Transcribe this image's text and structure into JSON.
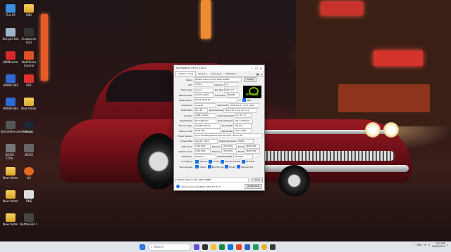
{
  "desktop": {
    "icons": [
      {
        "label": "This PC"
      },
      {
        "label": "MRI"
      },
      {
        "label": "Recycle Bin"
      },
      {
        "label": "Cinebench R23"
      },
      {
        "label": "HWMonitor"
      },
      {
        "label": "NeXtPulse Control"
      },
      {
        "label": "HWiNFO64"
      },
      {
        "label": "PDF"
      },
      {
        "label": "HWiNFO64"
      },
      {
        "label": "New folder"
      },
      {
        "label": "DetroitBecomeHuman"
      },
      {
        "label": "Steam"
      },
      {
        "label": "DS3Gi - CON..."
      },
      {
        "label": "DS3Gi"
      },
      {
        "label": "New folder"
      },
      {
        "label": "LIA"
      },
      {
        "label": "New folder"
      },
      {
        "label": "DNS"
      },
      {
        "label": "New folder"
      },
      {
        "label": "BattleField 1"
      }
    ]
  },
  "gpuz": {
    "title": "TechPowerUp GPU-Z 2.60.0",
    "controls": [
      "–",
      "□",
      "✕"
    ],
    "tabs": [
      "Graphics Card",
      "Sensors",
      "Advanced",
      "Validation"
    ],
    "tab_icons": [
      "camera",
      "menu"
    ],
    "name_label": "Name",
    "name_value": "NVIDIA GeForce GTX 1660 SUPER",
    "lookup": "Lookup",
    "gpu_label": "GPU",
    "gpu_value": "TU116",
    "revision_label": "Revision",
    "revision_value": "A1",
    "tech_label": "Technology",
    "tech_value": "12 nm",
    "diesize_label": "Die Size",
    "diesize_value": "284 mm²",
    "release_label": "Release Date",
    "release_value": "Oct 29, 2019",
    "transistors_label": "Transistors",
    "transistors_value": "6600M",
    "bios_label": "BIOS Version",
    "bios_value": "90.16.4F.40.7E",
    "uefi_label": "UEFI",
    "subvendor_label": "Subvendor",
    "subvendor_value": "Colorful",
    "deviceid_label": "Device ID",
    "deviceid_value": "10DE 21C4 - 7377 1001",
    "rops_label": "ROPs/TMUs",
    "rops_value": "48 / 88",
    "businterface_label": "Bus Interface",
    "businterface_value": "PCIe x16 3.0 @ x16 1.1",
    "shaders_label": "Shaders",
    "shaders_value": "1408 Unified",
    "dx_label": "DirectX Support",
    "dx_value": "12 (12_1)",
    "pixel_label": "Pixel Fillrate",
    "pixel_value": "87.8 GPixel/s",
    "texture_label": "Texture Fillrate",
    "texture_value": "161.0 GTexel/s",
    "memtype_label": "Memory Type",
    "memtype_value": "GDDR6 (Hynix)",
    "buswidth_label": "Bus Width",
    "buswidth_value": "192 bit",
    "memsize_label": "Memory Size",
    "memsize_value": "6144 MB",
    "bandwidth_label": "Bandwidth",
    "bandwidth_value": "336.0 GB/s",
    "driverver_label": "Driver Version",
    "driverver_value": "32.0.15.6590 (NVIDIA 565.90) DCH / Win11 64",
    "driverdate_label": "Driver Date",
    "driverdate_value": "Sep 26, 2024",
    "digsig_label": "Digital Signature",
    "digsig_value": "WHQL",
    "gpuclock_label": "GPU Clock",
    "gpuclock_value": "1530 MHz",
    "memory_label": "Memory",
    "memory_value": "1750 MHz",
    "boost_label": "Boost",
    "boost_value": "1830 MHz",
    "defclock_label": "Default Clock",
    "defclock_value": "1530 MHz",
    "defmemory_value": "1750 MHz",
    "defboost_value": "1830 MHz",
    "sli_label": "NVIDIA SLI",
    "sli_value": "Disabled",
    "rebar_label": "Resizable BAR",
    "rebar_value": "Disabled",
    "computing_label": "Computing",
    "computing": [
      "OpenCL",
      "CUDA",
      "DirectCompute",
      "DirectML"
    ],
    "tech_row_label": "Technologies",
    "technologies": [
      "Vulkan",
      "Ray Tracing",
      "PhysX",
      "OpenGL 4.6"
    ],
    "selected_card": "NVIDIA GeForce GTX 1660 SUPER",
    "close": "Close",
    "update_msg": "New version available: GPU-Z 2.61.0",
    "update_btn": "Update Now"
  },
  "taskbar": {
    "search_placeholder": "Search",
    "tray_lang": "ENG",
    "time": "4:55 PM",
    "date": "10/23/2024"
  }
}
